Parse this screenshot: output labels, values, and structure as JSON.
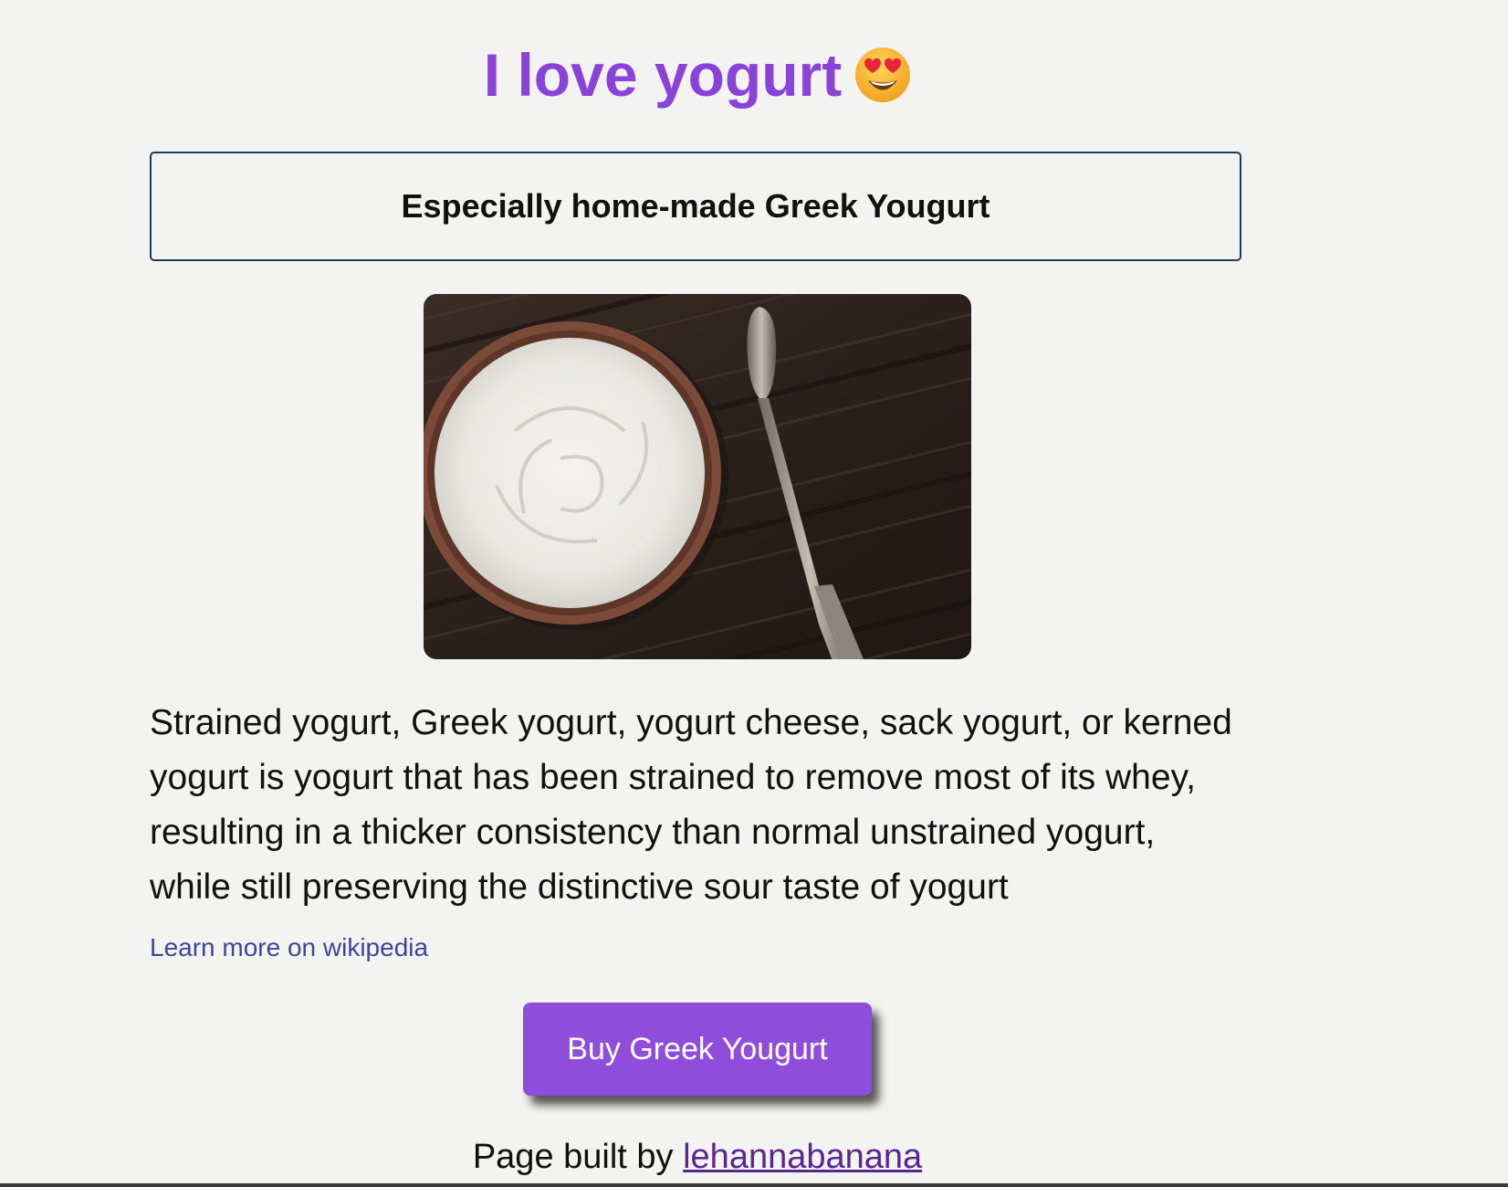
{
  "header": {
    "title": "I love yogurt",
    "title_emoji": "heart-eyes-emoji",
    "subtitle": "Especially home-made Greek Yougurt"
  },
  "photo": {
    "icon": "yogurt-bowl-with-spoon-photo"
  },
  "content": {
    "description": "Strained yogurt, Greek yogurt, yogurt cheese, sack yogurt, or kerned yogurt is yogurt that has been strained to remove most of its whey, resulting in a thicker consistency than normal unstrained yogurt, while still preserving the distinctive sour taste of yogurt",
    "wiki_link": "Learn more on wikipedia"
  },
  "cta": {
    "buy_label": "Buy Greek Yougurt"
  },
  "footer": {
    "prefix": "Page built by",
    "author": "lehannabanana"
  },
  "colors": {
    "accent": "#8a43d9",
    "button": "#8e4ddb",
    "link": "#3b4699",
    "visited_link": "#5a2691",
    "box_border": "#1b3b5f",
    "background": "#f3f4f1"
  }
}
